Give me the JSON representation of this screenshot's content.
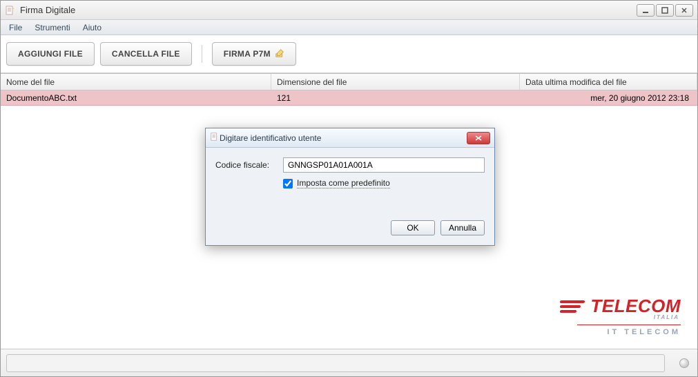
{
  "window": {
    "title": "Firma Digitale"
  },
  "menu": {
    "items": [
      "File",
      "Strumenti",
      "Aiuto"
    ]
  },
  "toolbar": {
    "add_file": "AGGIUNGI FILE",
    "delete_file": "CANCELLA FILE",
    "sign_p7m": "FIRMA P7M"
  },
  "table": {
    "headers": {
      "name": "Nome del file",
      "size": "Dimensione del file",
      "date": "Data ultima modifica del file"
    },
    "rows": [
      {
        "name": "DocumentoABC.txt",
        "size": "121",
        "date": "mer, 20 giugno 2012 23:18"
      }
    ]
  },
  "dialog": {
    "title": "Digitare identificativo utente",
    "field_label": "Codice fiscale:",
    "field_value": "GNNGSP01A01A001A",
    "checkbox_label": "Imposta come predefinito",
    "checkbox_checked": true,
    "ok": "OK",
    "cancel": "Annulla"
  },
  "branding": {
    "logo_text": "TELECOM",
    "logo_sub1": "ITALIA",
    "logo_sub2": "IT TELECOM"
  },
  "colors": {
    "brand_red": "#d1242a",
    "row_highlight": "#efc4c8"
  }
}
